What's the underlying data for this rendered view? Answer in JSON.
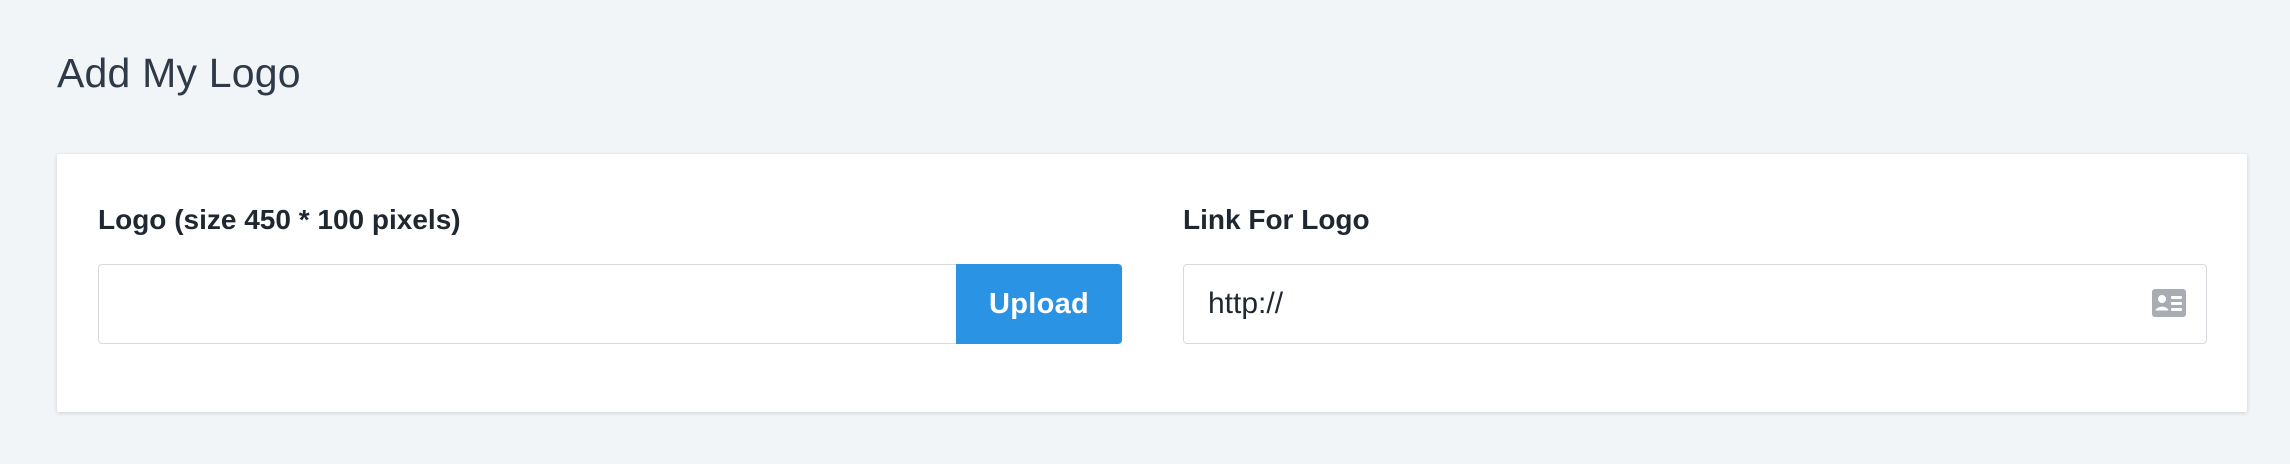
{
  "page": {
    "title": "Add My Logo"
  },
  "logo_field": {
    "label": "Logo (size 450 * 100 pixels)",
    "value": "",
    "placeholder": "",
    "upload_label": "Upload"
  },
  "link_field": {
    "label": "Link For Logo",
    "value": "http://",
    "icon": "id-card-icon"
  },
  "colors": {
    "background": "#f2f5f8",
    "card": "#ffffff",
    "accent": "#2a93e4",
    "text": "#2b3440",
    "border": "#d6d9dd",
    "icon": "#a8adb3"
  }
}
